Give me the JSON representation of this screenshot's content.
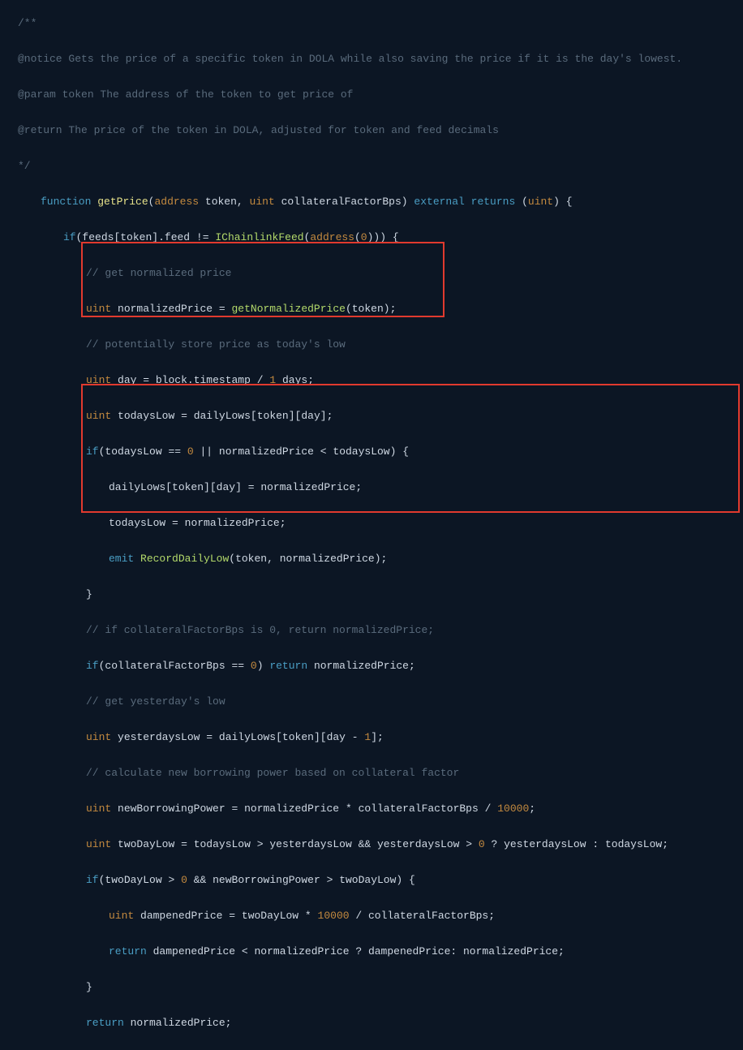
{
  "comments": {
    "doc1": "/**",
    "doc2": "@notice Gets the price of a specific token in DOLA while also saving the price if it is the day's lowest.",
    "doc3": "@param token The address of the token to get price of",
    "doc4": "@return The price of the token in DOLA, adjusted for token and feed decimals",
    "doc5": "*/",
    "c1": "// get normalized price",
    "c2": "// potentially store price as today's low",
    "c3": "// if collateralFactorBps is 0, return normalizedPrice;",
    "c4": "// get yesterday's low",
    "c5": "// calculate new borrowing power based on collateral factor"
  },
  "kw": {
    "function": "function",
    "if": "if",
    "return": "return",
    "emit": "emit",
    "external": "external",
    "returns": "returns"
  },
  "types": {
    "address": "address",
    "uint": "uint"
  },
  "idents": {
    "getPrice": "getPrice",
    "token": "token",
    "collateralFactorBps": "collateralFactorBps",
    "feeds": "feeds",
    "feed": "feed",
    "IChainlinkFeed": "IChainlinkFeed",
    "normalizedPrice": "normalizedPrice",
    "getNormalizedPrice": "getNormalizedPrice",
    "day": "day",
    "block": "block",
    "timestamp": "timestamp",
    "days": "days",
    "todaysLow": "todaysLow",
    "dailyLows": "dailyLows",
    "RecordDailyLow": "RecordDailyLow",
    "yesterdaysLow": "yesterdaysLow",
    "newBorrowingPower": "newBorrowingPower",
    "twoDayLow": "twoDayLow",
    "dampenedPrice": "dampenedPrice"
  },
  "nums": {
    "zero": "0",
    "one": "1",
    "tenThousand": "10000"
  },
  "punc": {
    "lparen": "(",
    "rparen": ")",
    "lbrace": "{",
    "rbrace": "}",
    "lbrack": "[",
    "rbrack": "]",
    "comma": ",",
    "semi": ";",
    "dot": ".",
    "eq": "=",
    "eqeq": "==",
    "neq": "!=",
    "lt": "<",
    "gt": ">",
    "or": "||",
    "and": "&&",
    "star": "*",
    "slash": "/",
    "minus": "-",
    "qmark": "?",
    "colon": ":"
  }
}
